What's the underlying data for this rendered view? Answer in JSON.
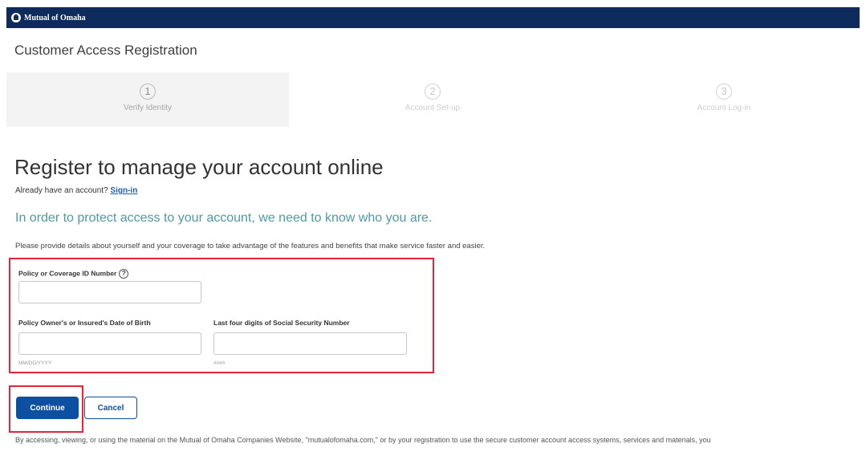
{
  "brand": {
    "logo_text": "Mutual of Omaha"
  },
  "app_title": "Customer Access Registration",
  "steps": [
    {
      "number": "1",
      "label": "Verify Identity",
      "active": true
    },
    {
      "number": "2",
      "label": "Account Set-up",
      "active": false
    },
    {
      "number": "3",
      "label": "Account Log-in",
      "active": false
    }
  ],
  "heading": "Register to manage your account online",
  "signin": {
    "prompt": "Already have an account?",
    "link": "Sign-in"
  },
  "subheading": "In order to protect access to your account, we need to know who you are.",
  "intro": "Please provide details about yourself and your coverage to take advantage of the features and benefits that make service faster and easier.",
  "form": {
    "policy_label": "Policy or Coverage ID Number",
    "policy_help_icon": "?",
    "policy_value": "",
    "dob_label": "Policy Owner's or Insured's Date of Birth",
    "dob_value": "",
    "dob_hint": "MM/DD/YYYY",
    "ssn_label": "Last four digits of Social Security Number",
    "ssn_value": "",
    "ssn_hint": "####"
  },
  "buttons": {
    "continue": "Continue",
    "cancel": "Cancel"
  },
  "legal": "By accessing, viewing, or using the material on the Mutual of Omaha Companies Website, \"mutualofomaha.com,\" or by your registration to use the secure customer account access systems, services and materials, you",
  "colors": {
    "header": "#0d2b5c",
    "primary": "#0d4fa0",
    "highlight": "#e1253a",
    "accent_text": "#4e9aa6"
  }
}
